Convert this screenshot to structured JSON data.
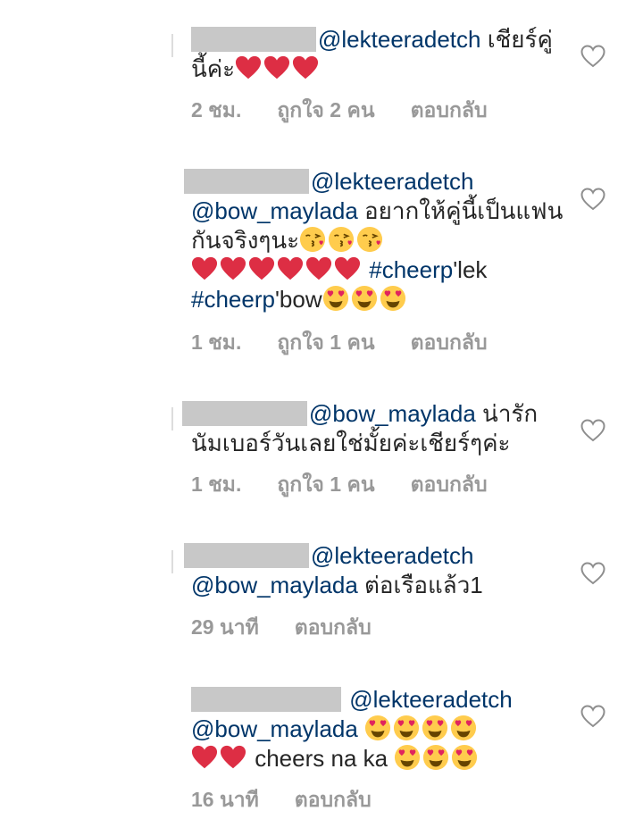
{
  "comments": [
    {
      "mention1": "@lekteeradetch",
      "text1": " เชียร์คู่นี้ค่ะ",
      "emojis": [
        "heart",
        "heart",
        "heart"
      ],
      "time": "2 ชม.",
      "likes": "ถูกใจ 2 คน",
      "reply": "ตอบกลับ"
    },
    {
      "mention1": "@lekteeradetch",
      "mention2": "@bow_maylada",
      "text1": " อยากให้คู่นี้เป็นแฟนกันจริงๆนะ",
      "hashtag1": "#cheerp",
      "hashtag1_suffix": "'lek",
      "hashtag2": "#cheerp",
      "hashtag2_suffix": "'bow",
      "time": "1 ชม.",
      "likes": "ถูกใจ 1 คน",
      "reply": "ตอบกลับ"
    },
    {
      "mention1": "@bow_maylada",
      "text1": " น่ารักนัมเบอร์วันเลยใช่มั้ยค่ะเชียร์ๆค่ะ",
      "time": "1 ชม.",
      "likes": "ถูกใจ 1 คน",
      "reply": "ตอบกลับ"
    },
    {
      "mention1": "@lekteeradetch",
      "mention2": "@bow_maylada",
      "text1": " ต่อเรือแล้ว1",
      "time": "29 นาที",
      "reply": "ตอบกลับ"
    },
    {
      "mention1": "@lekteeradetch",
      "mention2": "@bow_maylada",
      "text1": " cheers na ka",
      "time": "16 นาที",
      "reply": "ตอบกลับ"
    }
  ],
  "colors": {
    "mention": "#003569",
    "meta": "#999999",
    "heart_emoji": "#dd2e44",
    "redaction": "#c8c8c8"
  },
  "icons": {
    "like": "heart-outline-icon",
    "emoji_heart": "red-heart-emoji",
    "emoji_kiss": "face-blowing-kiss-emoji",
    "emoji_heart_eyes": "heart-eyes-emoji"
  }
}
